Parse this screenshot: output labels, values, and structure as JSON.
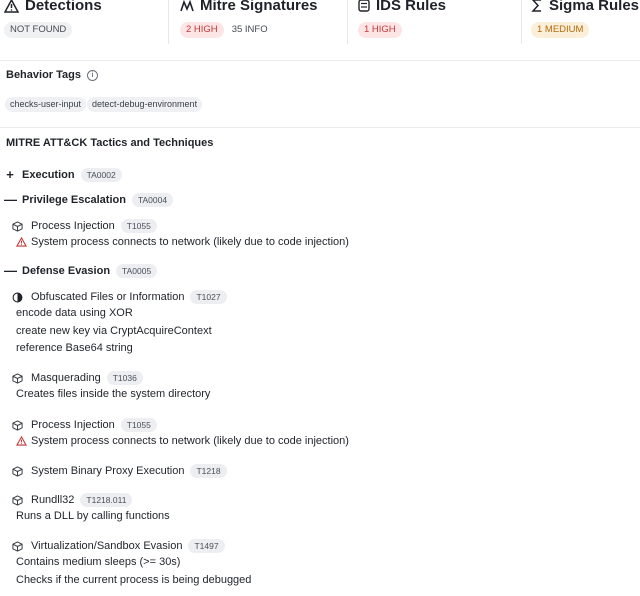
{
  "header": {
    "detections": {
      "title": "Detections",
      "badges": [
        "NOT FOUND"
      ]
    },
    "mitre": {
      "title": "Mitre Signatures",
      "badge_high": "2 HIGH",
      "badge_info": "35 INFO"
    },
    "ids": {
      "title": "IDS Rules",
      "badge_high": "1 HIGH"
    },
    "sigma": {
      "title": "Sigma Rules",
      "badge_medium": "1 MEDIUM"
    }
  },
  "behavior": {
    "title": "Behavior Tags",
    "tags": [
      "checks-user-input",
      "detect-debug-environment"
    ]
  },
  "mitre_section": {
    "title": "MITRE ATT&CK Tactics and Techniques",
    "tactics": [
      {
        "toggle": "+",
        "name": "Execution",
        "id": "TA0002"
      },
      {
        "toggle": "—",
        "name": "Privilege Escalation",
        "id": "TA0004"
      },
      {
        "toggle": "—",
        "name": "Defense Evasion",
        "id": "TA0005"
      }
    ],
    "techniques": [
      {
        "name": "Process Injection",
        "id": "T1055",
        "icon": "cube-icon",
        "lines": [
          {
            "text": "System process connects to network (likely due to code injection)",
            "warning": true
          }
        ]
      },
      {
        "name": "Obfuscated Files or Information",
        "id": "T1027",
        "icon": "circle-half-icon",
        "lines": [
          {
            "text": "encode data using XOR"
          },
          {
            "text": "create new key via CryptAcquireContext"
          },
          {
            "text": "reference Base64 string"
          }
        ]
      },
      {
        "name": "Masquerading",
        "id": "T1036",
        "icon": "cube-icon",
        "lines": [
          {
            "text": "Creates files inside the system directory"
          }
        ]
      },
      {
        "name": "Process Injection",
        "id": "T1055",
        "icon": "cube-icon",
        "lines": [
          {
            "text": "System process connects to network (likely due to code injection)",
            "warning": true
          }
        ]
      },
      {
        "name": "System Binary Proxy Execution",
        "id": "T1218",
        "icon": "cube-icon",
        "lines": []
      },
      {
        "name": "Rundll32",
        "id": "T1218.011",
        "icon": "cube-icon",
        "lines": [
          {
            "text": "Runs a DLL by calling functions"
          }
        ]
      },
      {
        "name": "Virtualization/Sandbox Evasion",
        "id": "T1497",
        "icon": "cube-icon",
        "lines": [
          {
            "text": "Contains medium sleeps (>= 30s)"
          },
          {
            "text": "Checks if the current process is being debugged"
          }
        ]
      }
    ]
  },
  "colors": {
    "high": "#c43838",
    "medium": "#b5690c",
    "border": "#e9ebee"
  }
}
